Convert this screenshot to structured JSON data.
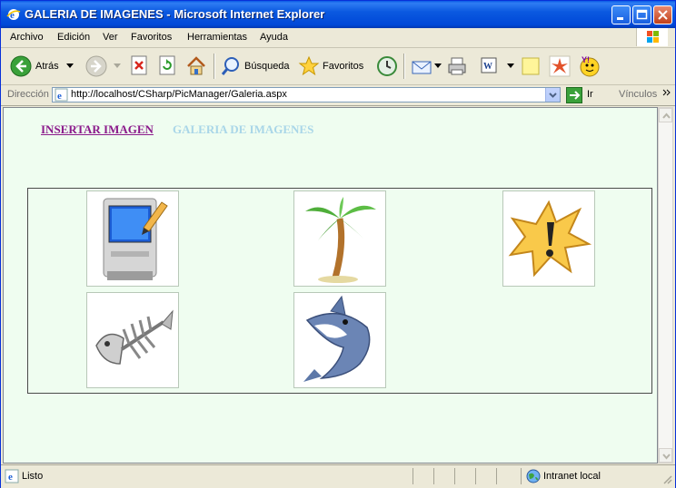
{
  "window": {
    "title": "GALERIA DE IMAGENES - Microsoft Internet Explorer"
  },
  "menu": {
    "items": [
      "Archivo",
      "Edición",
      "Ver",
      "Favoritos",
      "Herramientas",
      "Ayuda"
    ]
  },
  "toolbar": {
    "back_label": "Atrás",
    "search_label": "Búsqueda",
    "favorites_label": "Favoritos"
  },
  "address": {
    "label": "Dirección",
    "url": "http://localhost/CSharp/PicManager/Galeria.aspx",
    "go_label": "Ir",
    "links_label": "Vínculos"
  },
  "page": {
    "nav_insert": "INSERTAR IMAGEN",
    "nav_gallery": "GALERIA DE IMAGENES",
    "images": [
      {
        "icon": "computer-icon"
      },
      {
        "icon": "palm-tree-icon"
      },
      {
        "icon": "warning-icon"
      },
      {
        "icon": "fish-skeleton-icon"
      },
      {
        "icon": "shark-icon"
      }
    ]
  },
  "status": {
    "text": "Listo",
    "zone": "Intranet local"
  },
  "colors": {
    "content_bg": "#effdf0",
    "link_visited": "#8b1a8b",
    "link_current": "#a9d6e8"
  }
}
